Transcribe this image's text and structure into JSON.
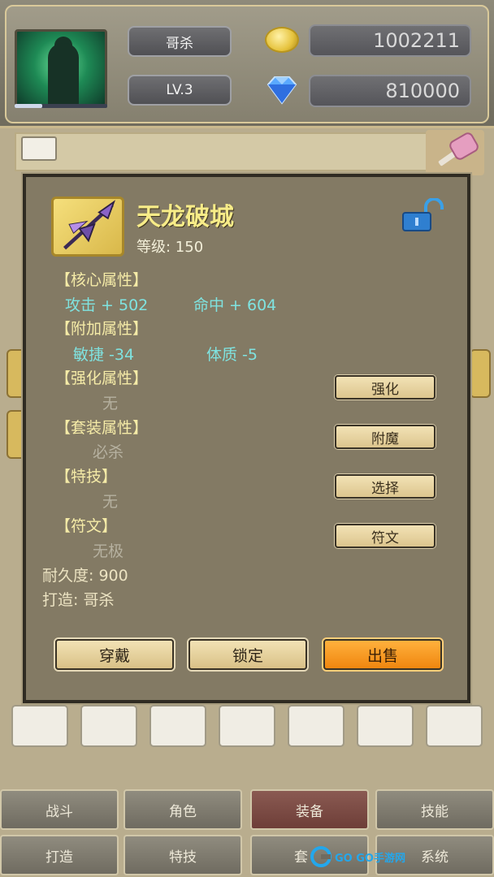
{
  "header": {
    "player_name": "哥杀",
    "level": "LV.3",
    "gold": "1002211",
    "gems": "810000",
    "xp_progress": 0.3
  },
  "item": {
    "name": "天龙破城",
    "level_text": "等级: 150",
    "core_title": "【核心属性】",
    "core_attrs": [
      "攻击 + 502",
      "命中 + 604"
    ],
    "extra_title": "【附加属性】",
    "extra_attrs": [
      "敏捷  -34",
      "体质  -5"
    ],
    "enhance_title": "【强化属性】",
    "enhance_value": "无",
    "set_title": "【套装属性】",
    "set_value": "必杀",
    "skill_title": "【特技】",
    "skill_value": "无",
    "rune_title": "【符文】",
    "rune_value": "无极",
    "durability": "耐久度:  900",
    "crafted_by": "打造:  哥杀"
  },
  "side_buttons": [
    "强化",
    "附魔",
    "选择",
    "符文"
  ],
  "action_buttons": {
    "equip": "穿戴",
    "lock": "锁定",
    "sell": "出售"
  },
  "nav": {
    "row1": [
      "战斗",
      "角色",
      "装备",
      "技能"
    ],
    "row2": [
      "打造",
      "特技",
      "套",
      "系统"
    ],
    "active": "装备"
  },
  "watermark": "GO GO手游网",
  "colors": {
    "item_name": "#f7ec88",
    "core_attr": "#7fe3e0",
    "sell_button": "#f0860f",
    "active_nav": "#7a4a44"
  }
}
